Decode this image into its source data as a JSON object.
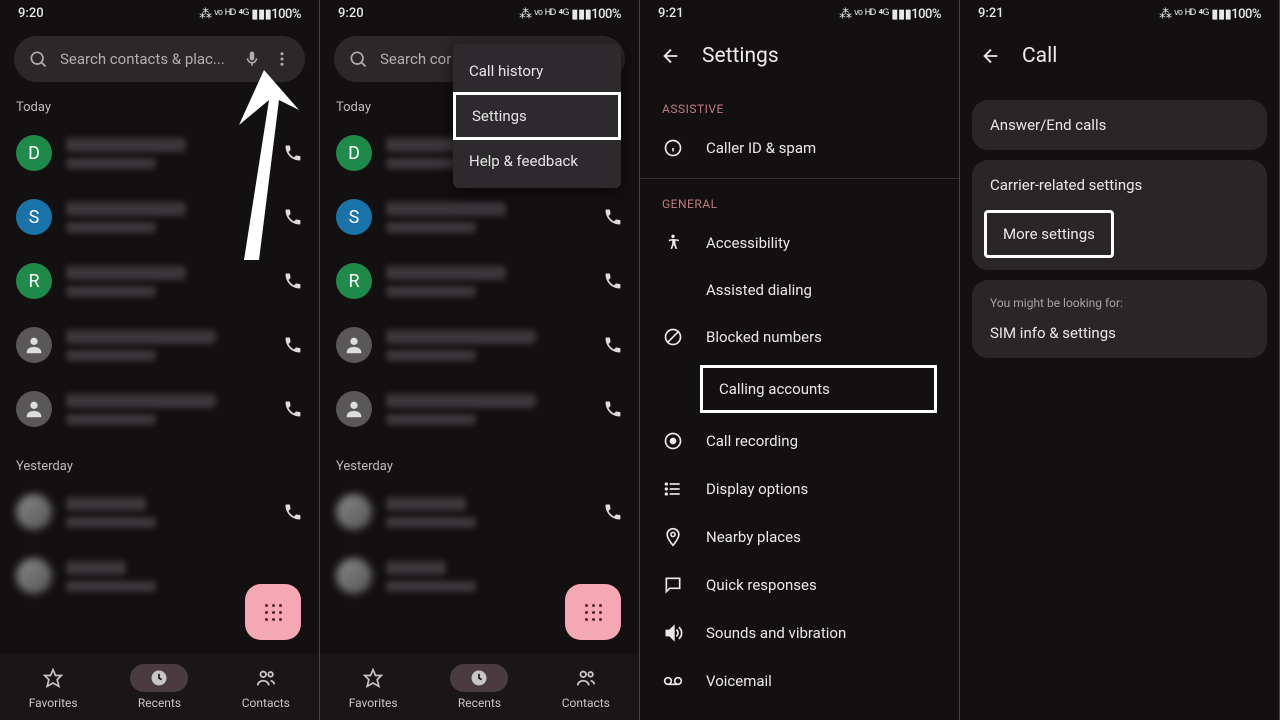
{
  "status": {
    "time1": "9:20",
    "time2": "9:21",
    "right": "⁂ ᵛᵒ ᴴᴰ ⁴ᴳ ▮▮▮100%"
  },
  "search": {
    "placeholder_full": "Search contacts & plac...",
    "placeholder_short": "Search cor"
  },
  "sections": {
    "today": "Today",
    "yesterday": "Yesterday"
  },
  "avatars": [
    "D",
    "S",
    "R"
  ],
  "nav": {
    "favorites": "Favorites",
    "recents": "Recents",
    "contacts": "Contacts"
  },
  "popup": {
    "call_history": "Call history",
    "settings": "Settings",
    "help": "Help & feedback"
  },
  "p3": {
    "title": "Settings",
    "assistive": "ASSISTIVE",
    "caller_id": "Caller ID & spam",
    "general": "GENERAL",
    "accessibility": "Accessibility",
    "assisted": "Assisted dialing",
    "blocked": "Blocked numbers",
    "calling_accounts": "Calling accounts",
    "recording": "Call recording",
    "display": "Display options",
    "nearby": "Nearby places",
    "quick": "Quick responses",
    "sounds": "Sounds and vibration",
    "voicemail": "Voicemail"
  },
  "p4": {
    "title": "Call",
    "answer": "Answer/End calls",
    "carrier": "Carrier-related settings",
    "more": "More settings",
    "looking": "You might be looking for:",
    "sim": "SIM info & settings"
  }
}
